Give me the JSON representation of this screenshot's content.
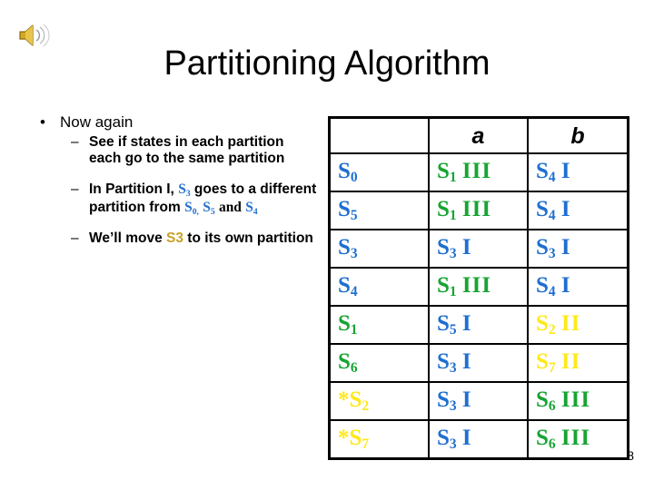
{
  "slide": {
    "title": "Partitioning Algorithm",
    "page_number": "8",
    "sound_icon": "speaker-icon"
  },
  "colors": {
    "blue": "#1F6FD0",
    "green": "#17A433",
    "yellow": "#FFE81A",
    "gold": "#C9A227",
    "black": "#000000"
  },
  "body": {
    "bullet1": {
      "marker": "•",
      "text": "Now again"
    },
    "sub1": {
      "marker": "–",
      "text": "See if states in each partition each go to the same partition"
    },
    "sub2": {
      "marker": "–",
      "part1": "In Partition I,",
      "state_a": "S",
      "state_a_sub": "3",
      "part2": "goes to a different partition from",
      "state_b": "S",
      "state_b_sub": "0,",
      "state_c": "S",
      "state_c_sub": "5",
      "conj": "and",
      "state_d": "S",
      "state_d_sub": "4"
    },
    "sub3": {
      "marker": "–",
      "part1": "We’ll move",
      "highlight": "S3",
      "part2": "to its own partition"
    }
  },
  "table": {
    "headers": [
      "",
      "a",
      "b"
    ],
    "rows": [
      {
        "state": {
          "prefix": "",
          "label": "S",
          "sub": "0",
          "color": "blue"
        },
        "a": {
          "label": "S",
          "sub": "1",
          "bars": "III",
          "color": "green"
        },
        "b": {
          "label": "S",
          "sub": "4",
          "bars": "I",
          "color": "blue"
        }
      },
      {
        "state": {
          "prefix": "",
          "label": "S",
          "sub": "5",
          "color": "blue"
        },
        "a": {
          "label": "S",
          "sub": "1",
          "bars": "III",
          "color": "green"
        },
        "b": {
          "label": "S",
          "sub": "4",
          "bars": "I",
          "color": "blue"
        }
      },
      {
        "state": {
          "prefix": "",
          "label": "S",
          "sub": "3",
          "color": "blue"
        },
        "a": {
          "label": "S",
          "sub": "3",
          "bars": "I",
          "color": "blue"
        },
        "b": {
          "label": "S",
          "sub": "3",
          "bars": "I",
          "color": "blue"
        }
      },
      {
        "state": {
          "prefix": "",
          "label": "S",
          "sub": "4",
          "color": "blue"
        },
        "a": {
          "label": "S",
          "sub": "1",
          "bars": "III",
          "color": "green"
        },
        "b": {
          "label": "S",
          "sub": "4",
          "bars": "I",
          "color": "blue"
        }
      },
      {
        "state": {
          "prefix": "",
          "label": "S",
          "sub": "1",
          "color": "green"
        },
        "a": {
          "label": "S",
          "sub": "5",
          "bars": "I",
          "color": "blue"
        },
        "b": {
          "label": "S",
          "sub": "2",
          "bars": "II",
          "color": "yellow"
        }
      },
      {
        "state": {
          "prefix": "",
          "label": "S",
          "sub": "6",
          "color": "green"
        },
        "a": {
          "label": "S",
          "sub": "3",
          "bars": "I",
          "color": "blue"
        },
        "b": {
          "label": "S",
          "sub": "7",
          "bars": "II",
          "color": "yellow"
        }
      },
      {
        "state": {
          "prefix": "*",
          "label": "S",
          "sub": "2",
          "color": "yellow"
        },
        "a": {
          "label": "S",
          "sub": "3",
          "bars": "I",
          "color": "blue"
        },
        "b": {
          "label": "S",
          "sub": "6",
          "bars": "III",
          "color": "green"
        }
      },
      {
        "state": {
          "prefix": "*",
          "label": "S",
          "sub": "7",
          "color": "yellow"
        },
        "a": {
          "label": "S",
          "sub": "3",
          "bars": "I",
          "color": "blue"
        },
        "b": {
          "label": "S",
          "sub": "6",
          "bars": "III",
          "color": "green"
        }
      }
    ]
  }
}
